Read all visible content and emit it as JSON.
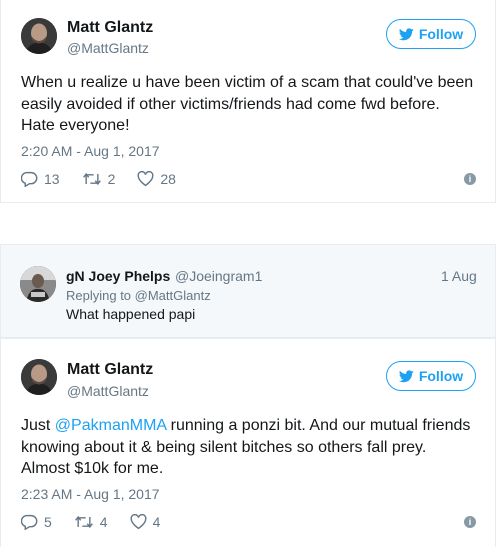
{
  "tweet1": {
    "name": "Matt Glantz",
    "handle": "@MattGlantz",
    "follow_label": "Follow",
    "text_line1": "When u realize u have been victim of a scam that could've been",
    "text_line2": "easily avoided if other victims/friends had come fwd before.",
    "text_line3": "Hate everyone!",
    "timestamp": "2:20 AM - Aug 1, 2017",
    "replies": "13",
    "retweets": "2",
    "likes": "28"
  },
  "reply": {
    "name": "gN Joey Phelps",
    "handle": "@Joeingram1",
    "date": "1 Aug",
    "replying_to": "Replying to @MattGlantz",
    "text": "What happened papi"
  },
  "tweet2": {
    "name": "Matt Glantz",
    "handle": "@MattGlantz",
    "follow_label": "Follow",
    "text_pre": "Just ",
    "mention": "@PakmanMMA",
    "text_line1_rest": " running a ponzi bit. And our mutual friends",
    "text_line2": "knowing about it & being silent bitches so others fall prey.",
    "text_line3": "Almost $10k for me.",
    "timestamp": "2:23 AM - Aug 1, 2017",
    "replies": "5",
    "retweets": "4",
    "likes": "4"
  },
  "icons": {
    "reply": "reply-icon",
    "retweet": "retweet-icon",
    "like": "heart-icon",
    "info": "info-icon",
    "twitter": "twitter-bird-icon"
  },
  "colors": {
    "accent": "#1da1f2",
    "muted": "#657786",
    "reply_bg": "#f5f8fa"
  }
}
